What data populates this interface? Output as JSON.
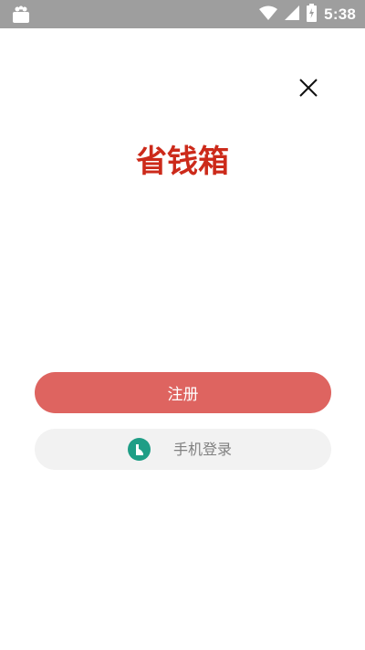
{
  "status_bar": {
    "time": "5:38",
    "left_icon": "android-store-icon",
    "right_icons": [
      "wifi-icon",
      "signal-icon",
      "battery-icon"
    ],
    "background_color": "#9e9e9e"
  },
  "header": {
    "close_icon": "close-icon"
  },
  "app": {
    "title": "省钱箱",
    "title_color": "#cc2a1a"
  },
  "actions": {
    "register_label": "注册",
    "register_color": "#de6460",
    "phone_login_label": "手机登录",
    "phone_login_icon": "phone-icon",
    "phone_icon_color": "#1f9e86"
  }
}
